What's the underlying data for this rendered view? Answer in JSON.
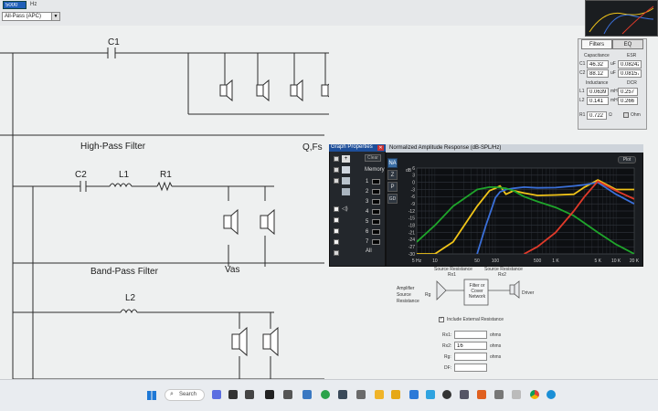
{
  "top_bar": {
    "field_value": "5000",
    "unit": "Hz",
    "mode_select": "All-Pass (APC)"
  },
  "schematic": {
    "c1": "C1",
    "high_pass_title": "High-Pass Filter",
    "qfs_label": "Q,Fs",
    "c2": "C2",
    "l1": "L1",
    "r1": "R1",
    "band_pass_title": "Band-Pass Filter",
    "vas_label": "Vas",
    "l2": "L2"
  },
  "right_panel": {
    "tabs": [
      "Filters",
      "EQ"
    ],
    "capacitance_label": "Capacitance",
    "esr_label": "ESR",
    "c1_label": "C1",
    "c1_value": "46.32",
    "c1_unit": "uF",
    "c1_esr": "0.08242",
    "c2_label": "C2",
    "c2_value": "88.12",
    "c2_unit": "uF",
    "c2_esr": "0.08157",
    "inductance_label": "Inductance",
    "dcr_label": "DCR",
    "l1_label": "L1",
    "l1_value": "0.0639",
    "l1_unit": "mH",
    "l1_dcr": "0.257",
    "l2_label": "L2",
    "l2_value": "0.141",
    "l2_unit": "mH",
    "l2_dcr": "0.266",
    "r1_label": "R1",
    "r1_value": "0.722",
    "r1_unit": "Ω",
    "ohm_label": "Ohm"
  },
  "graph_properties": {
    "title": "Graph Properties",
    "clear_btn": "Clear",
    "memory_label": "Memory",
    "side_buttons": [
      "NA",
      "Z",
      "P",
      "GD"
    ],
    "memory_slots": [
      "1",
      "2",
      "3",
      "4",
      "5",
      "6",
      "7",
      "All"
    ]
  },
  "graph": {
    "title": "Normalized Amplitude Response (dB-SPL/Hz)",
    "plot_btn": "Plot",
    "y_unit": "dB",
    "x_ticks": [
      "5 Hz",
      "10",
      "50",
      "100",
      "500",
      "1 K",
      "5 K",
      "10 K",
      "20 K"
    ],
    "y_ticks": [
      "6",
      "3",
      "0",
      "-3",
      "-6",
      "-9",
      "-12",
      "-15",
      "-18",
      "-21",
      "-24",
      "-27",
      "-30"
    ]
  },
  "chart_data": {
    "type": "line",
    "title": "Normalized Amplitude Response (dB-SPL/Hz)",
    "xlabel": "",
    "ylabel": "dB",
    "xscale": "log",
    "xlim": [
      5,
      20000
    ],
    "ylim": [
      -30,
      6
    ],
    "grid": true,
    "series": [
      {
        "color": "#f0c419",
        "x": [
          5,
          10,
          20,
          50,
          80,
          100,
          120,
          150,
          200,
          300,
          500,
          1000,
          2000,
          3000,
          5000,
          10000,
          20000
        ],
        "y": [
          -30,
          -30,
          -25,
          -10,
          -3.5,
          -2.5,
          -1.5,
          -5,
          -3.5,
          -4.5,
          -5.5,
          -5.3,
          -5,
          -2,
          1,
          -3,
          -3
        ]
      },
      {
        "color": "#3a6fd8",
        "x": [
          50,
          70,
          90,
          100,
          120,
          150,
          200,
          300,
          500,
          1000,
          2000,
          3000,
          5000,
          10000,
          20000
        ],
        "y": [
          -30,
          -18,
          -10,
          -6.5,
          -4,
          -3,
          -2.5,
          -2,
          -2.3,
          -2.2,
          -1.5,
          -1,
          0,
          -5,
          -9
        ]
      },
      {
        "color": "#1fa52b",
        "x": [
          5,
          10,
          20,
          50,
          80,
          100,
          150,
          200,
          300,
          500,
          1000,
          2000,
          5000,
          10000,
          20000
        ],
        "y": [
          -25,
          -18,
          -10,
          -3,
          -2,
          -2,
          -2.5,
          -3.5,
          -6,
          -8,
          -10.5,
          -14,
          -21,
          -26,
          -30
        ]
      },
      {
        "color": "#e03a2a",
        "x": [
          300,
          500,
          1000,
          2000,
          3000,
          5000,
          10000,
          20000
        ],
        "y": [
          -30,
          -27,
          -21,
          -12,
          -6,
          0.5,
          -3.5,
          -7
        ]
      }
    ]
  },
  "crossover": {
    "source_resistance": "Source Resistance",
    "rx1_top": "Rx1",
    "source_resistance_2": "Source Resistance",
    "rx2_top": "Rx2",
    "amplifier_label": "Amplifier Source Resistance",
    "rg_label": "Rg",
    "filter_label": "Filter or Cover Network",
    "driver_label": "Driver",
    "include_label": "Include External Resistance",
    "rx1_label": "Rx1:",
    "rx1_value": "",
    "rx1_unit": "ohms",
    "rx2_label": "Rx2:",
    "rx2_value": "16",
    "rx2_unit": "ohms",
    "rg_field_label": "Rg:",
    "rg_value": "",
    "rg_unit": "ohms",
    "df_label": "DF:",
    "df_value": ""
  },
  "taskbar": {
    "search_label": "Search"
  },
  "colors": {
    "yellow": "#f0c419",
    "blue": "#3a6fd8",
    "green": "#1fa52b",
    "red": "#e03a2a",
    "graph_bg": "#0d0f12",
    "title_bar": "#1e4f9a"
  }
}
